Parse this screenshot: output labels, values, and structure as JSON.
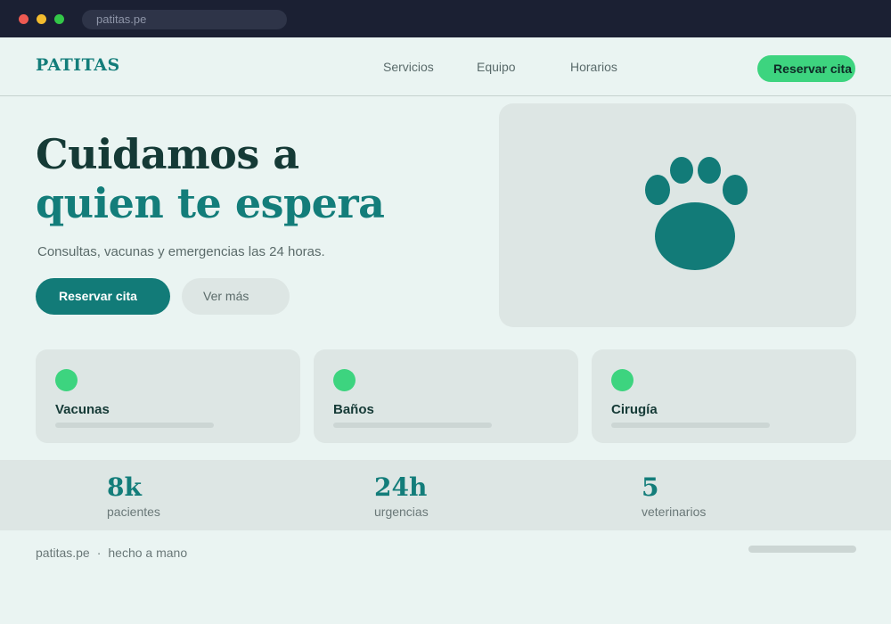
{
  "browser": {
    "url": "patitas.pe"
  },
  "nav": {
    "logo": "PATITAS",
    "links": [
      "Servicios",
      "Equipo",
      "Horarios"
    ],
    "cta": "Reservar cita"
  },
  "hero": {
    "title_line1": "Cuidamos a",
    "title_line2": "quien te espera",
    "subtitle": "Consultas, vacunas y emergencias las 24 horas.",
    "primary_button": "Reservar cita",
    "secondary_button": "Ver más",
    "image_icon": "paw-icon"
  },
  "services": [
    {
      "title": "Vacunas",
      "icon": "dot-icon"
    },
    {
      "title": "Baños",
      "icon": "dot-icon"
    },
    {
      "title": "Cirugía",
      "icon": "dot-icon"
    }
  ],
  "stats": [
    {
      "value": "8k",
      "label": "pacientes"
    },
    {
      "value": "24h",
      "label": "urgencias"
    },
    {
      "value": "5",
      "label": "veterinarios"
    }
  ],
  "footer": {
    "site": "patitas.pe",
    "separator": "·",
    "note": "hecho a mano"
  },
  "colors": {
    "brand": "#137d7a",
    "accent": "#3dd47f",
    "dark_text": "#153a36",
    "background": "#eaf4f2",
    "chrome": "#1b2033"
  }
}
